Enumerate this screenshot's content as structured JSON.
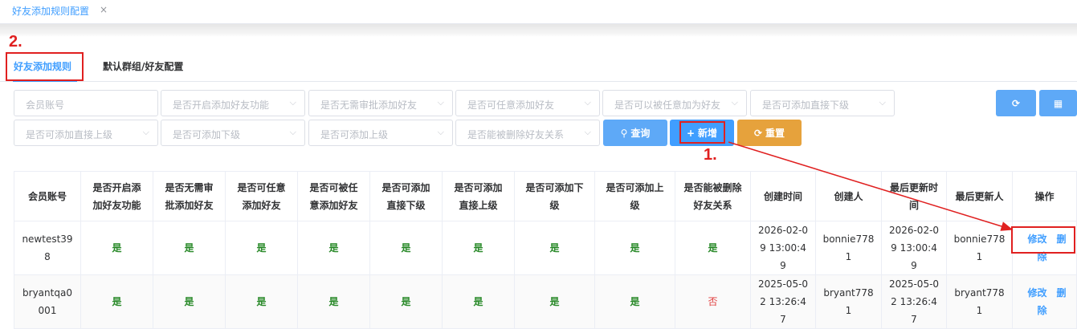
{
  "page_tab": {
    "title": "好友添加规则配置",
    "close": "×"
  },
  "annotations": {
    "step1": "1.",
    "step2": "2."
  },
  "tabs": [
    {
      "label": "好友添加规则",
      "active": true
    },
    {
      "label": "默认群组/好友配置",
      "active": false
    }
  ],
  "filters": {
    "account": "会员账号",
    "enable_add": "是否开启添加好友功能",
    "no_approval": "是否无需审批添加好友",
    "any_add": "是否可任意添加好友",
    "be_added_any": "是否可以被任意加为好友",
    "add_direct_sub": "是否可添加直接下级",
    "add_direct_sup": "是否可添加直接上级",
    "add_sub": "是否可添加下级",
    "add_sup": "是否可添加上级",
    "can_be_deleted": "是否能被删除好友关系"
  },
  "buttons": {
    "query": "查询",
    "add": "新增",
    "reset": "重置"
  },
  "table": {
    "headers": [
      "会员账号",
      "是否开启添加好友功能",
      "是否无需审批添加好友",
      "是否可任意添加好友",
      "是否可被任意添加好友",
      "是否可添加直接下级",
      "是否可添加直接上级",
      "是否可添加下级",
      "是否可添加上级",
      "是否能被删除好友关系",
      "创建时间",
      "创建人",
      "最后更新时间",
      "最后更新人",
      "操作"
    ],
    "rows": [
      {
        "account": "newtest398",
        "flags": [
          "是",
          "是",
          "是",
          "是",
          "是",
          "是",
          "是",
          "是",
          "是"
        ],
        "created": "2026-02-09 13:00:49",
        "creator": "bonnie7781",
        "updated": "2026-02-09 13:00:49",
        "updater": "bonnie7781"
      },
      {
        "account": "bryantqa0001",
        "flags": [
          "是",
          "是",
          "是",
          "是",
          "是",
          "是",
          "是",
          "是",
          "否"
        ],
        "created": "2025-05-02 13:26:47",
        "creator": "bryant7781",
        "updated": "2025-05-02 13:26:47",
        "updater": "bryant7781"
      }
    ],
    "actions": {
      "edit": "修改",
      "delete": "删除"
    }
  },
  "colors": {
    "accent": "#409eff",
    "warning": "#e6a23c",
    "annotation": "#e02020",
    "yes": "#2a8a2a",
    "no": "#e03c3c"
  }
}
